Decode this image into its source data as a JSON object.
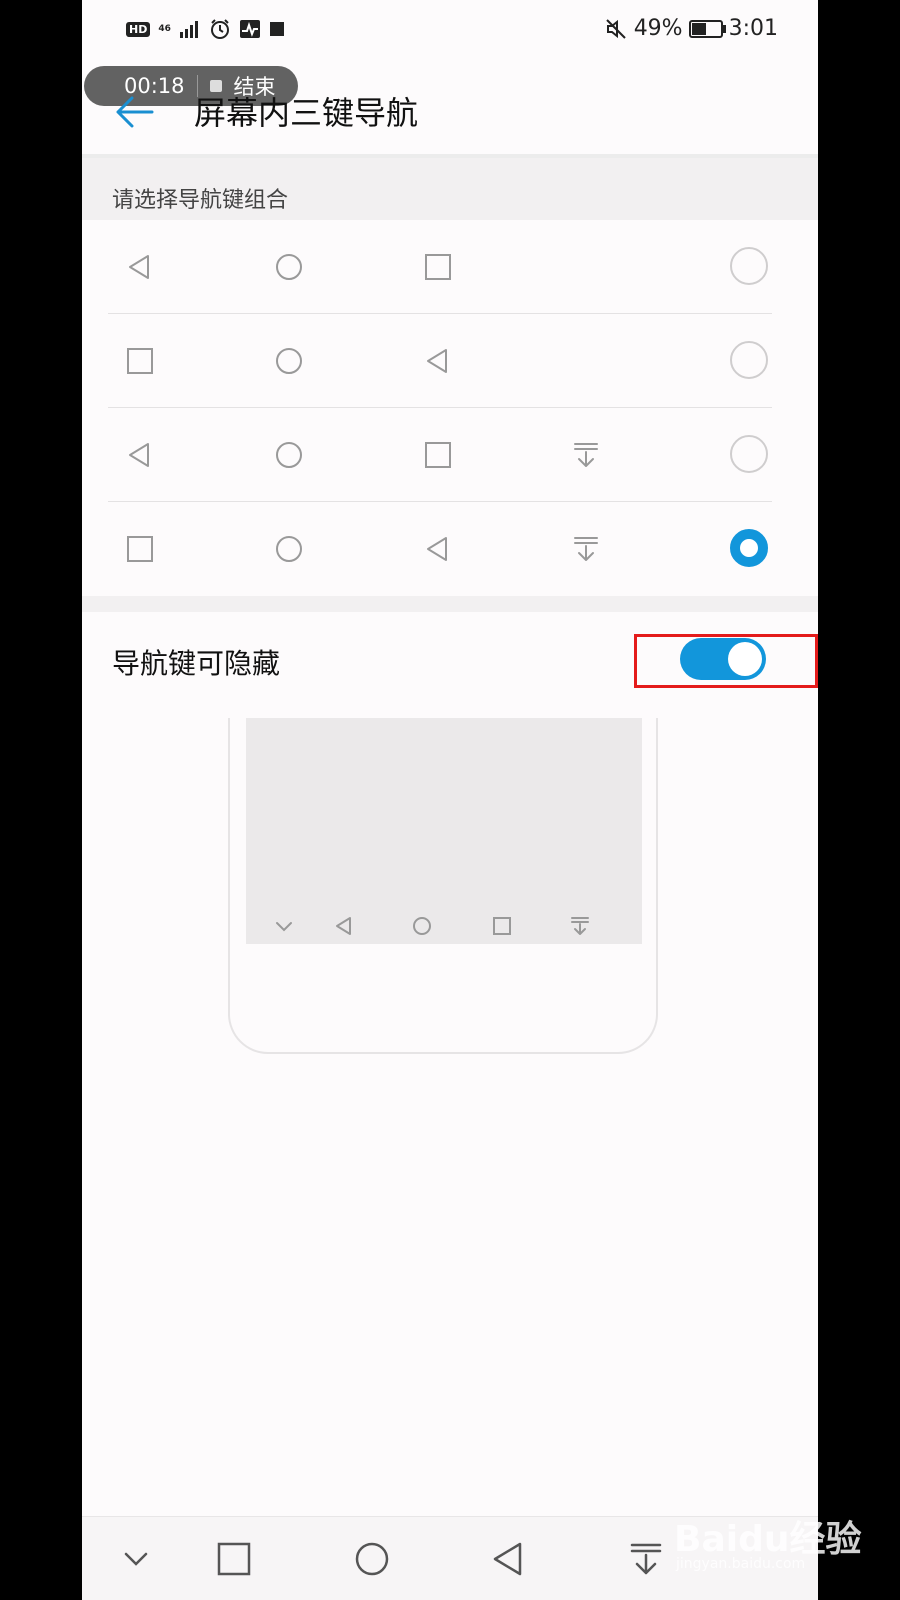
{
  "status_bar": {
    "hd": "HD",
    "network": "46",
    "battery": "49%",
    "battery_level": 0.49,
    "time": "3:01"
  },
  "recording": {
    "time": "00:18",
    "end_label": "结束"
  },
  "header": {
    "title": "屏幕内三键导航",
    "back_icon": "arrow-left-icon"
  },
  "section": {
    "label": "请选择导航键组合"
  },
  "options": [
    {
      "keys": [
        "back",
        "home",
        "recent"
      ],
      "selected": false
    },
    {
      "keys": [
        "recent",
        "home",
        "back"
      ],
      "selected": false
    },
    {
      "keys": [
        "back",
        "home",
        "recent",
        "hide"
      ],
      "selected": false
    },
    {
      "keys": [
        "recent",
        "home",
        "back",
        "hide"
      ],
      "selected": true
    }
  ],
  "toggle": {
    "label": "导航键可隐藏",
    "on": true
  },
  "illustration_nav": [
    "chevron-down",
    "back",
    "home",
    "recent",
    "hide"
  ],
  "bottom_nav": [
    "chevron-down",
    "recent",
    "home",
    "back",
    "hide"
  ],
  "colors": {
    "accent": "#1296db",
    "highlight": "#e41b1b",
    "background": "#fdfbfc"
  },
  "watermark": {
    "logo": "Baidu经验",
    "url": "jingyan.baidu.com"
  }
}
